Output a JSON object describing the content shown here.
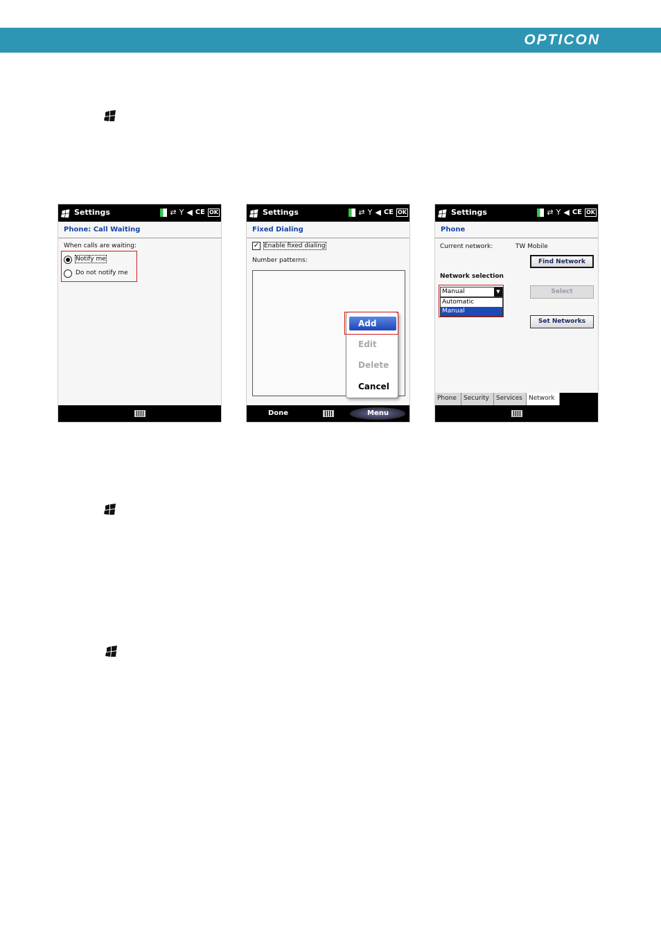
{
  "header": {
    "brand": "OPTICON",
    "brand_color": "#2d96b4"
  },
  "start_icon": "windows-start-icon",
  "screens": {
    "call_waiting": {
      "title": "Settings",
      "heading": "Phone: Call Waiting",
      "prompt": "When calls are waiting:",
      "options": [
        "Notify me",
        "Do not notify me"
      ],
      "selected": "Notify me"
    },
    "fixed_dialing": {
      "title": "Settings",
      "heading": "Fixed Dialing",
      "checkbox_label": "Enable fixed dialing",
      "checkbox_checked": true,
      "list_label": "Number patterns:",
      "menu_items": [
        "Add",
        "Edit",
        "Delete",
        "Cancel"
      ],
      "softkey_left": "Done",
      "softkey_right": "Menu"
    },
    "network": {
      "title": "Settings",
      "heading": "Phone",
      "current_network_label": "Current network:",
      "current_network_value": "TW Mobile",
      "find_network_button": "Find Network",
      "network_selection_label": "Network selection",
      "combo_value": "Manual",
      "dropdown_options": [
        "Automatic",
        "Manual"
      ],
      "select_button": "Select",
      "set_networks_button": "Set Networks",
      "tabs": [
        "Phone",
        "Security",
        "Services",
        "Network"
      ],
      "active_tab": "Network"
    }
  },
  "highlight_color": "#d81818",
  "selection_color": "#1c4ab7"
}
